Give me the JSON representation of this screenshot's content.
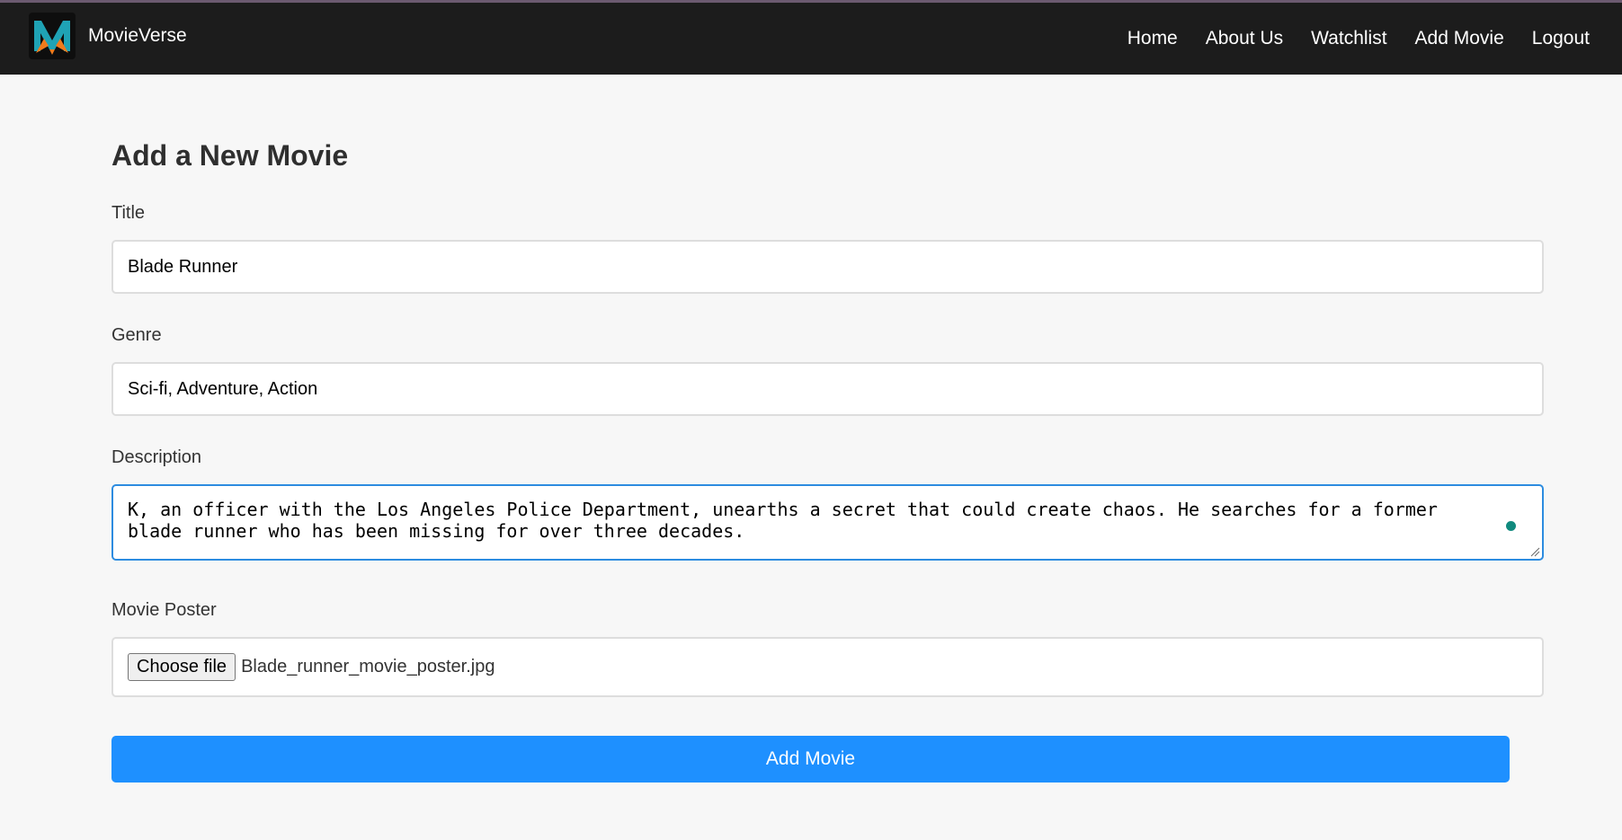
{
  "colors": {
    "navbar_bg": "#1c1c1c",
    "page_bg": "#f7f7f7",
    "accent": "#1e90ff",
    "focus_border": "#2d8ce0",
    "status_dot": "#118a7e"
  },
  "header": {
    "brand": "MovieVerse",
    "logo_icon": "movieverse-m-logo",
    "nav": [
      "Home",
      "About Us",
      "Watchlist",
      "Add Movie",
      "Logout"
    ]
  },
  "form": {
    "heading": "Add a New Movie",
    "title": {
      "label": "Title",
      "value": "Blade Runner"
    },
    "genre": {
      "label": "Genre",
      "value": "Sci-fi, Adventure, Action"
    },
    "description": {
      "label": "Description",
      "value": "K, an officer with the Los Angeles Police Department, unearths a secret that could create chaos. He searches for a former blade runner who has been missing for over three decades."
    },
    "poster": {
      "label": "Movie Poster",
      "button": "Choose file",
      "file_name": "Blade_runner_movie_poster.jpg"
    },
    "submit_label": "Add Movie"
  }
}
